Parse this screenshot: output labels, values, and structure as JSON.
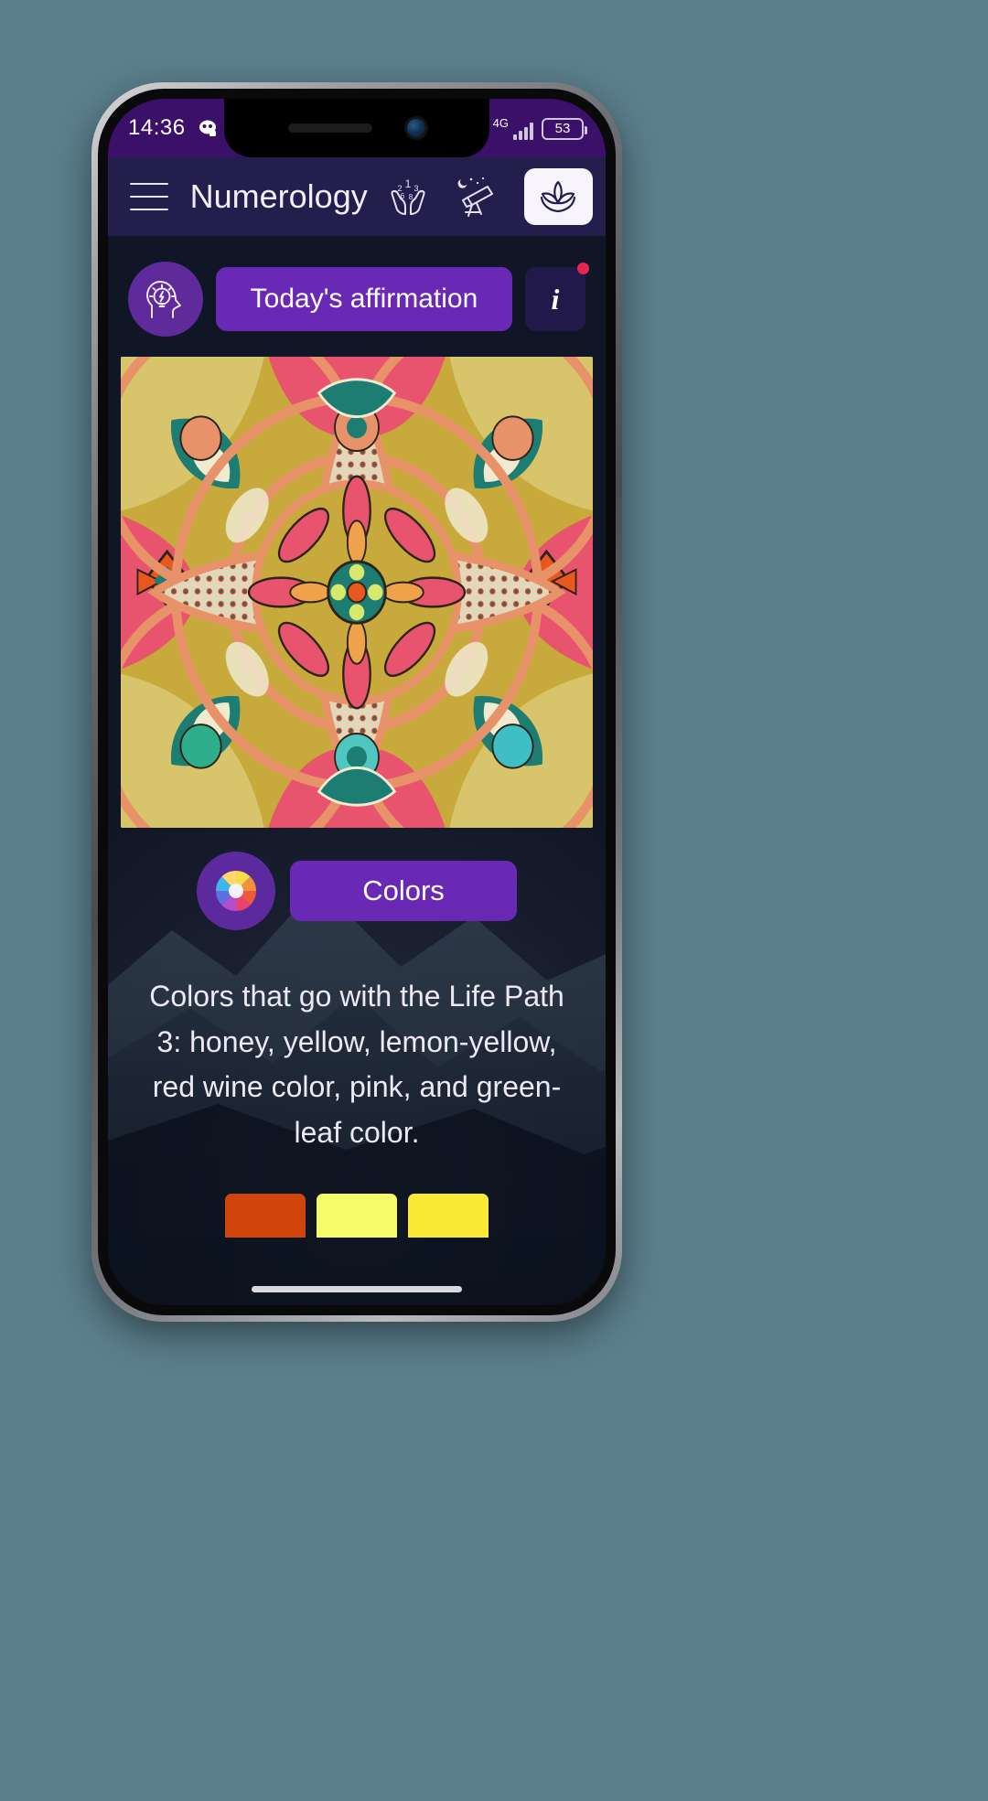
{
  "status_bar": {
    "time": "14:36",
    "icons": [
      "discord-icon",
      "more-dots-icon"
    ],
    "network_type": "4G",
    "battery_level": "53"
  },
  "header": {
    "menu_icon": "hamburger-menu-icon",
    "title": "Numerology",
    "nav_icons": [
      {
        "name": "hands-numbers-icon",
        "label": "Numerology"
      },
      {
        "name": "telescope-icon",
        "label": "Astronomy"
      },
      {
        "name": "lotus-icon",
        "label": "Meditation"
      }
    ]
  },
  "affirmation": {
    "icon": "head-lightbulb-icon",
    "label": "Today's affirmation",
    "info_label": "i",
    "has_notification": true
  },
  "mandala": {
    "name": "mandala-artwork",
    "palette": {
      "gold": "#c8a93c",
      "teal": "#1e7d73",
      "cream": "#f0ead0",
      "salmon": "#e8926a",
      "pink": "#e8546e",
      "orange": "#e8571b",
      "dark": "#2c2319"
    }
  },
  "colors_section": {
    "icon": "color-wheel-icon",
    "button_label": "Colors",
    "description": "Colors that go with the Life Path 3: honey, yellow, lemon-yellow, red wine color, pink, and green-leaf color."
  },
  "swatches": [
    {
      "name": "swatch-honey",
      "hex": "#d1450b"
    },
    {
      "name": "swatch-yellow",
      "hex": "#f4fc6a"
    },
    {
      "name": "swatch-lemon-yellow",
      "hex": "#fbe938"
    }
  ],
  "theme": {
    "status_bar_bg": "#3b1069",
    "header_bg": "#241e4d",
    "accent_purple": "#6a29b5",
    "icon_circle_purple": "#5c2a9e",
    "badge_red": "#e4274e",
    "page_bg": "#5b7f8c"
  }
}
